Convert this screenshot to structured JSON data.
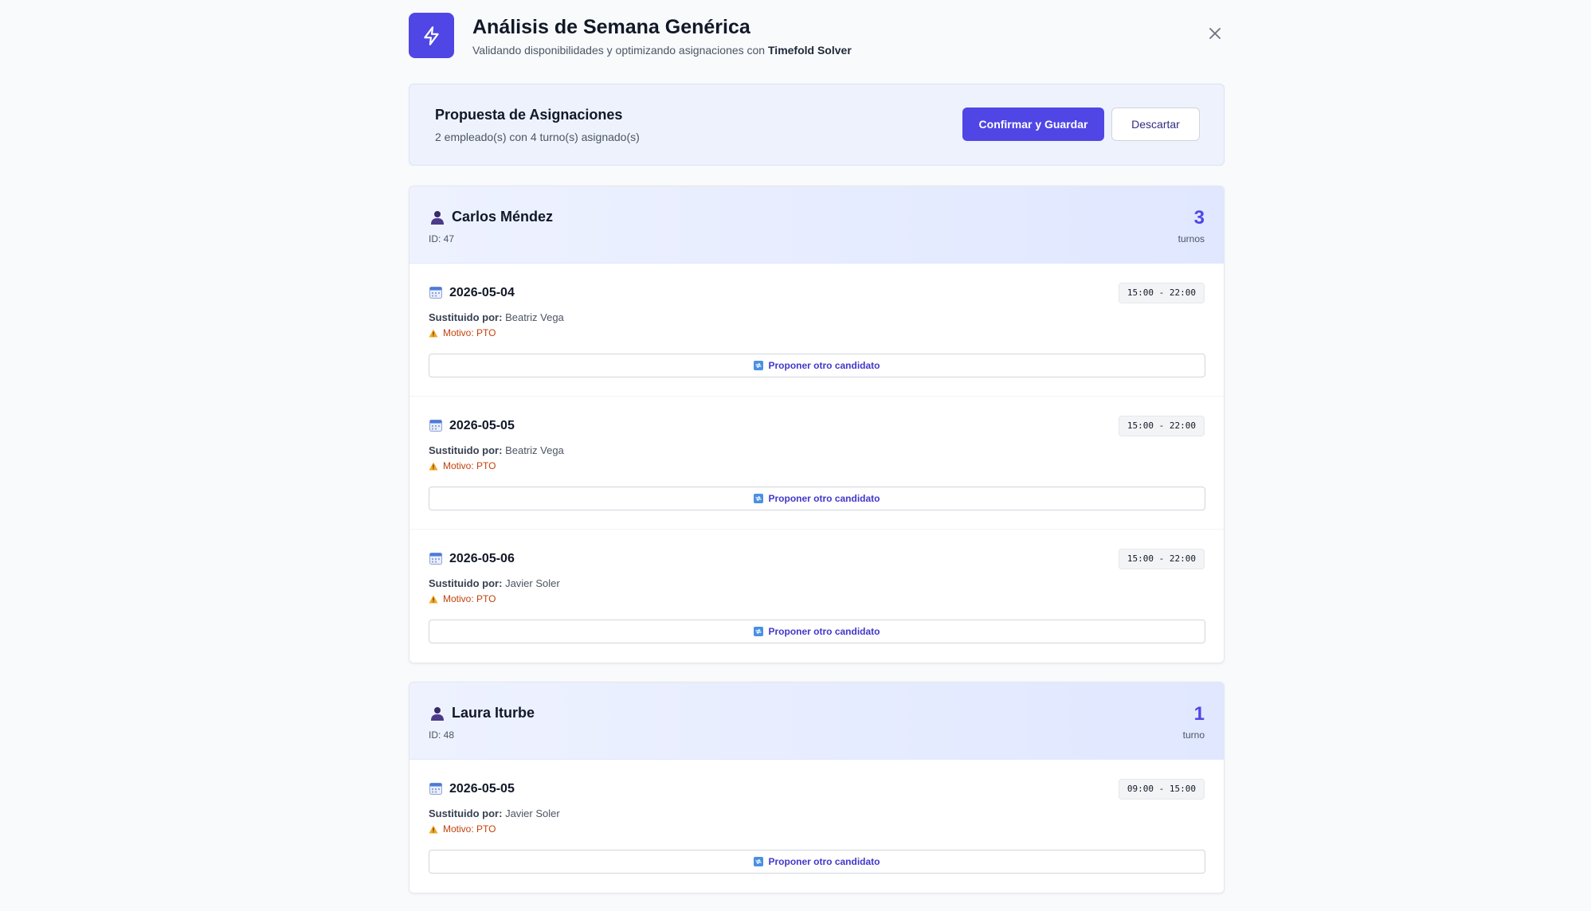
{
  "header": {
    "title": "Análisis de Semana Genérica",
    "subtitle_prefix": "Validando disponibilidades y optimizando asignaciones con ",
    "subtitle_bold": "Timefold Solver"
  },
  "proposal": {
    "title": "Propuesta de Asignaciones",
    "summary": "2 empleado(s) con 4 turno(s) asignado(s)",
    "confirm_label": "Confirmar y Guardar",
    "discard_label": "Descartar"
  },
  "labels": {
    "substituted_by": "Sustituido por:",
    "reason_prefix": "Motivo: ",
    "propose_label": "Proponer otro candidato"
  },
  "employees": [
    {
      "name": "Carlos Méndez",
      "id": "ID: 47",
      "count": "3",
      "count_label": "turnos",
      "shifts": [
        {
          "date": "2026-05-04",
          "time": "15:00 - 22:00",
          "substitute": "Beatriz Vega",
          "reason": "PTO"
        },
        {
          "date": "2026-05-05",
          "time": "15:00 - 22:00",
          "substitute": "Beatriz Vega",
          "reason": "PTO"
        },
        {
          "date": "2026-05-06",
          "time": "15:00 - 22:00",
          "substitute": "Javier Soler",
          "reason": "PTO"
        }
      ]
    },
    {
      "name": "Laura Iturbe",
      "id": "ID: 48",
      "count": "1",
      "count_label": "turno",
      "shifts": [
        {
          "date": "2026-05-05",
          "time": "09:00 - 15:00",
          "substitute": "Javier Soler",
          "reason": "PTO"
        }
      ]
    }
  ],
  "colors": {
    "accent": "#4f46e5",
    "warning": "#c2410c"
  },
  "icons": {
    "logo": "lightning-bolt-icon",
    "close": "close-icon",
    "employee": "user-icon",
    "date": "calendar-icon",
    "warning": "warning-icon",
    "propose": "swap-icon"
  }
}
